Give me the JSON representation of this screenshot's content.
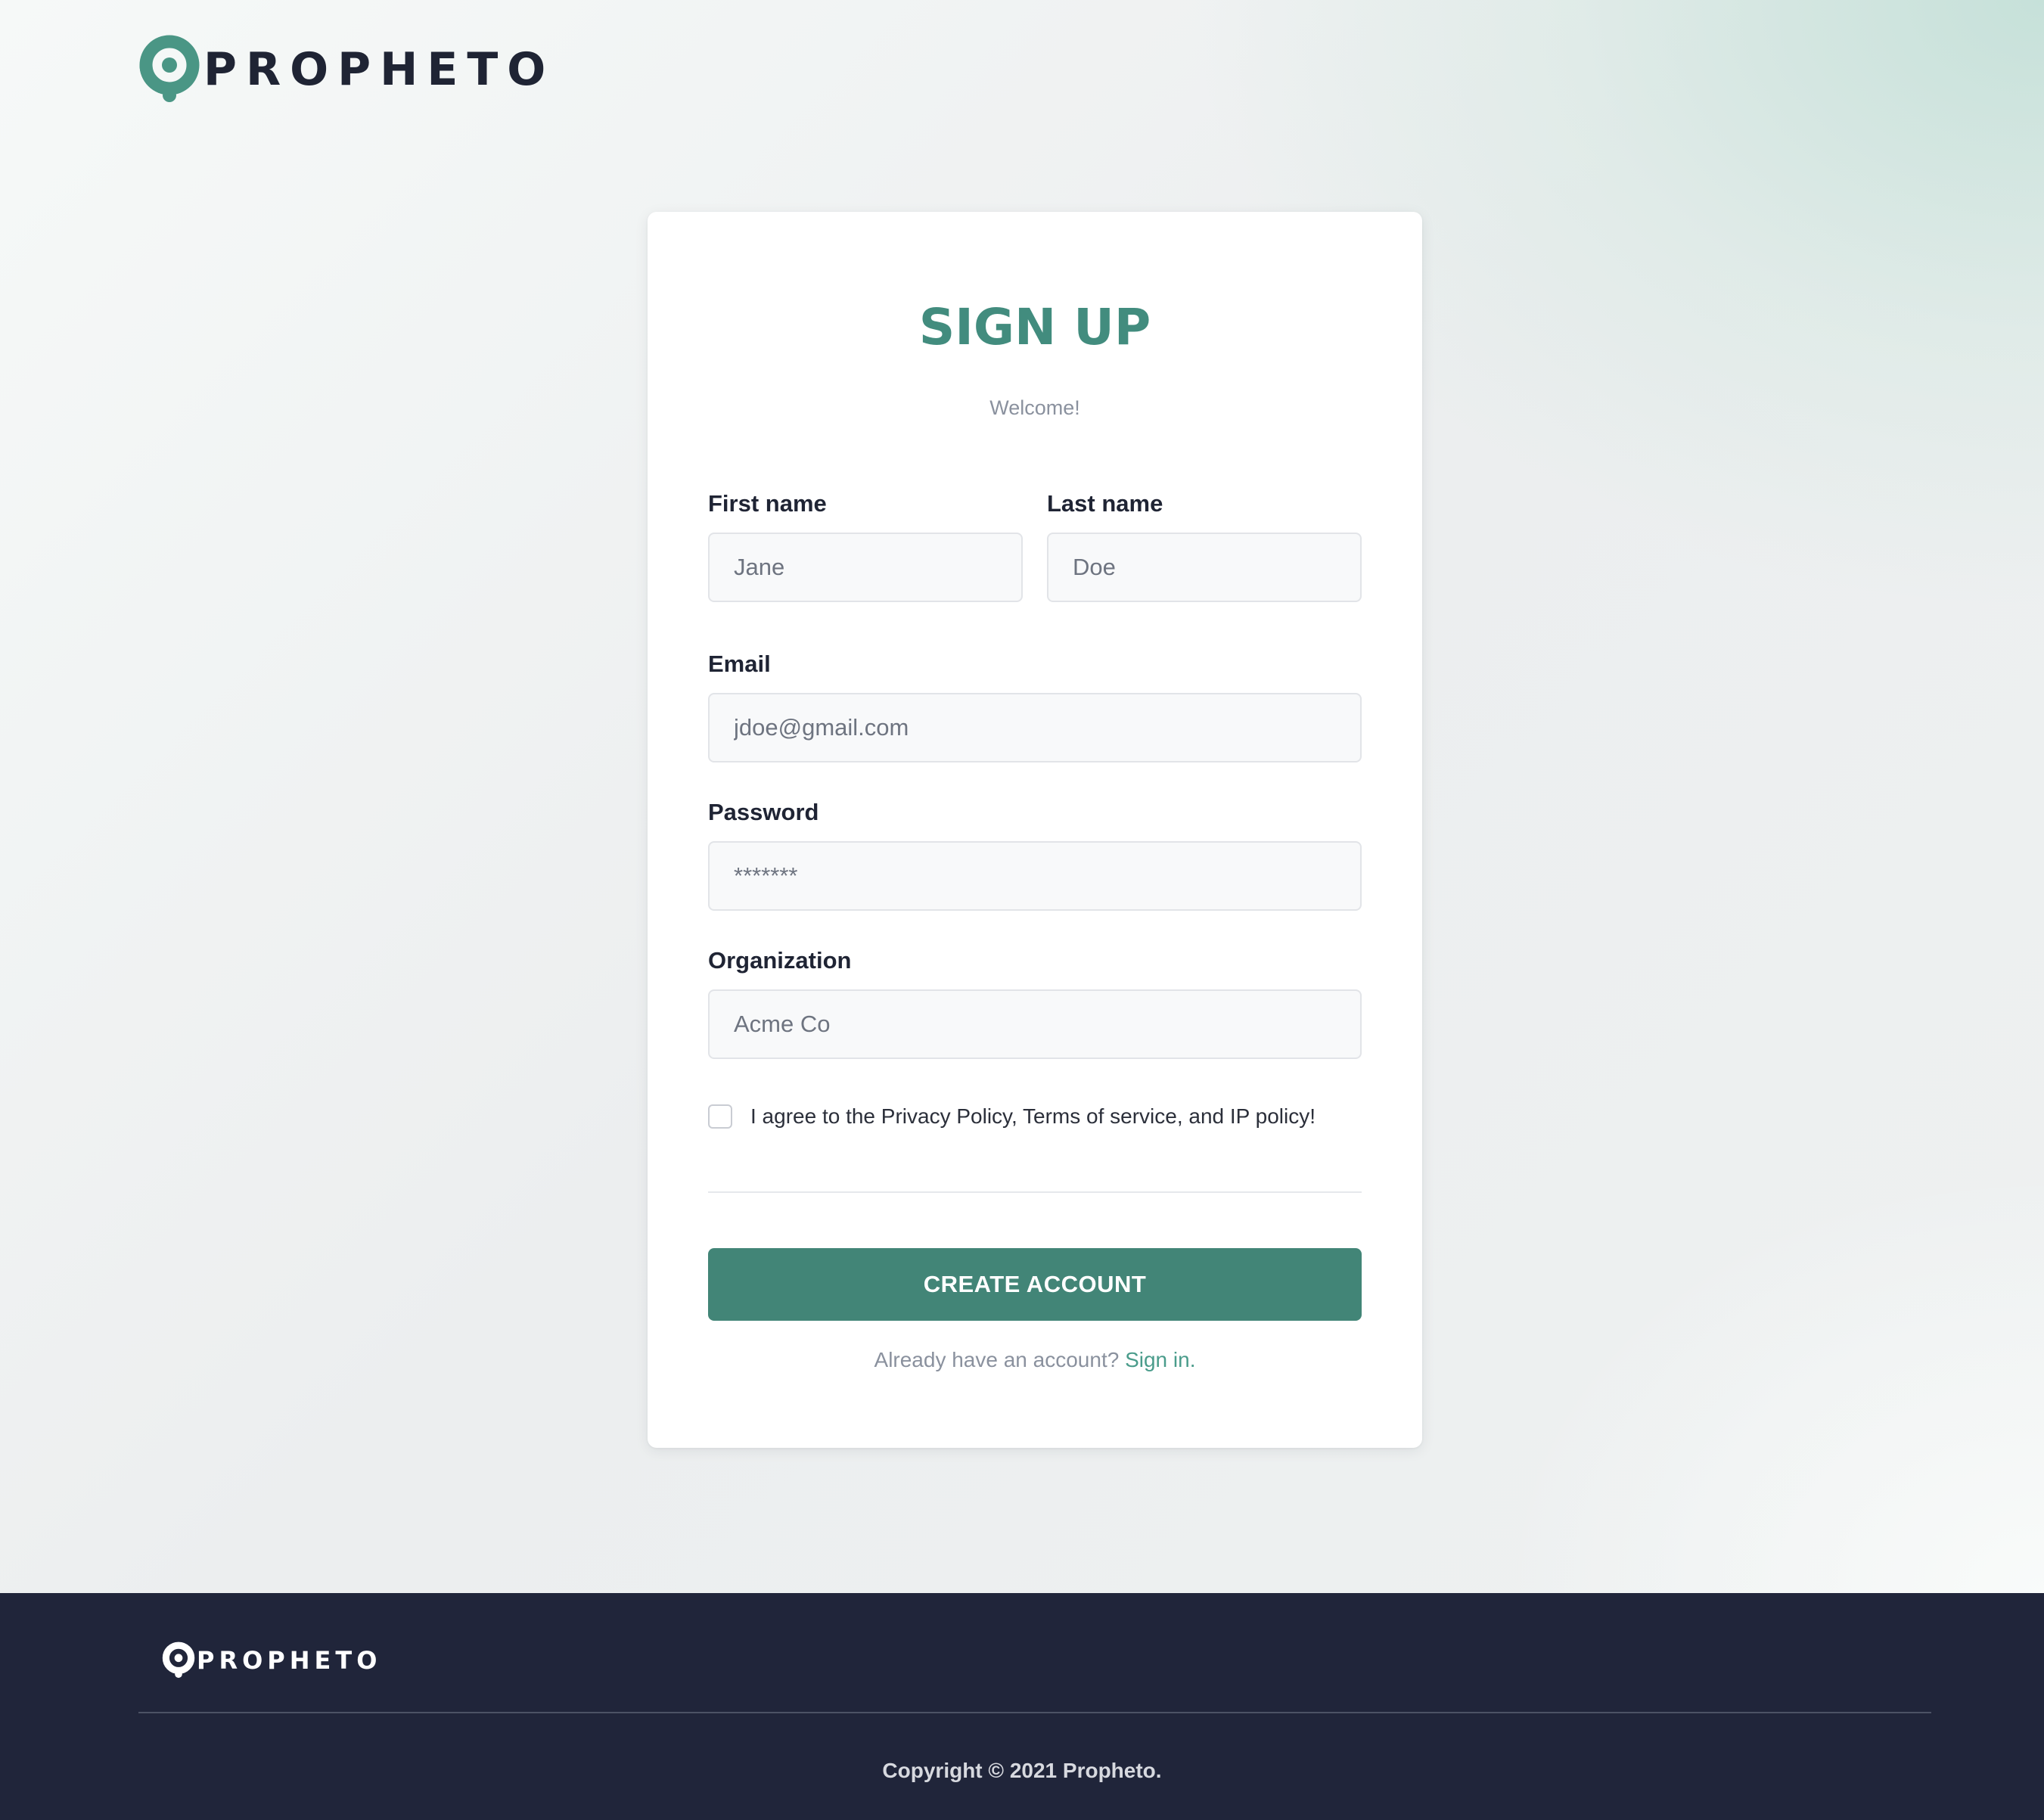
{
  "brand": {
    "name": "PROPHETO",
    "accent_color": "#428c7e",
    "logo_icon": "location-pin-icon"
  },
  "signup": {
    "title": "SIGN UP",
    "subtitle": "Welcome!",
    "first_name": {
      "label": "First name",
      "placeholder": "Jane"
    },
    "last_name": {
      "label": "Last name",
      "placeholder": "Doe"
    },
    "email": {
      "label": "Email",
      "placeholder": "jdoe@gmail.com"
    },
    "password": {
      "label": "Password",
      "placeholder": "*******"
    },
    "organization": {
      "label": "Organization",
      "placeholder": "Acme Co"
    },
    "agree_text": "I agree to the Privacy Policy, Terms of service, and IP policy!",
    "agree_checked": false,
    "submit_label": "CREATE ACCOUNT",
    "signin_prompt": "Already have an account?",
    "signin_link": "Sign in."
  },
  "footer": {
    "brand_name": "PROPHETO",
    "copyright": "Copyright © 2021 Propheto."
  }
}
